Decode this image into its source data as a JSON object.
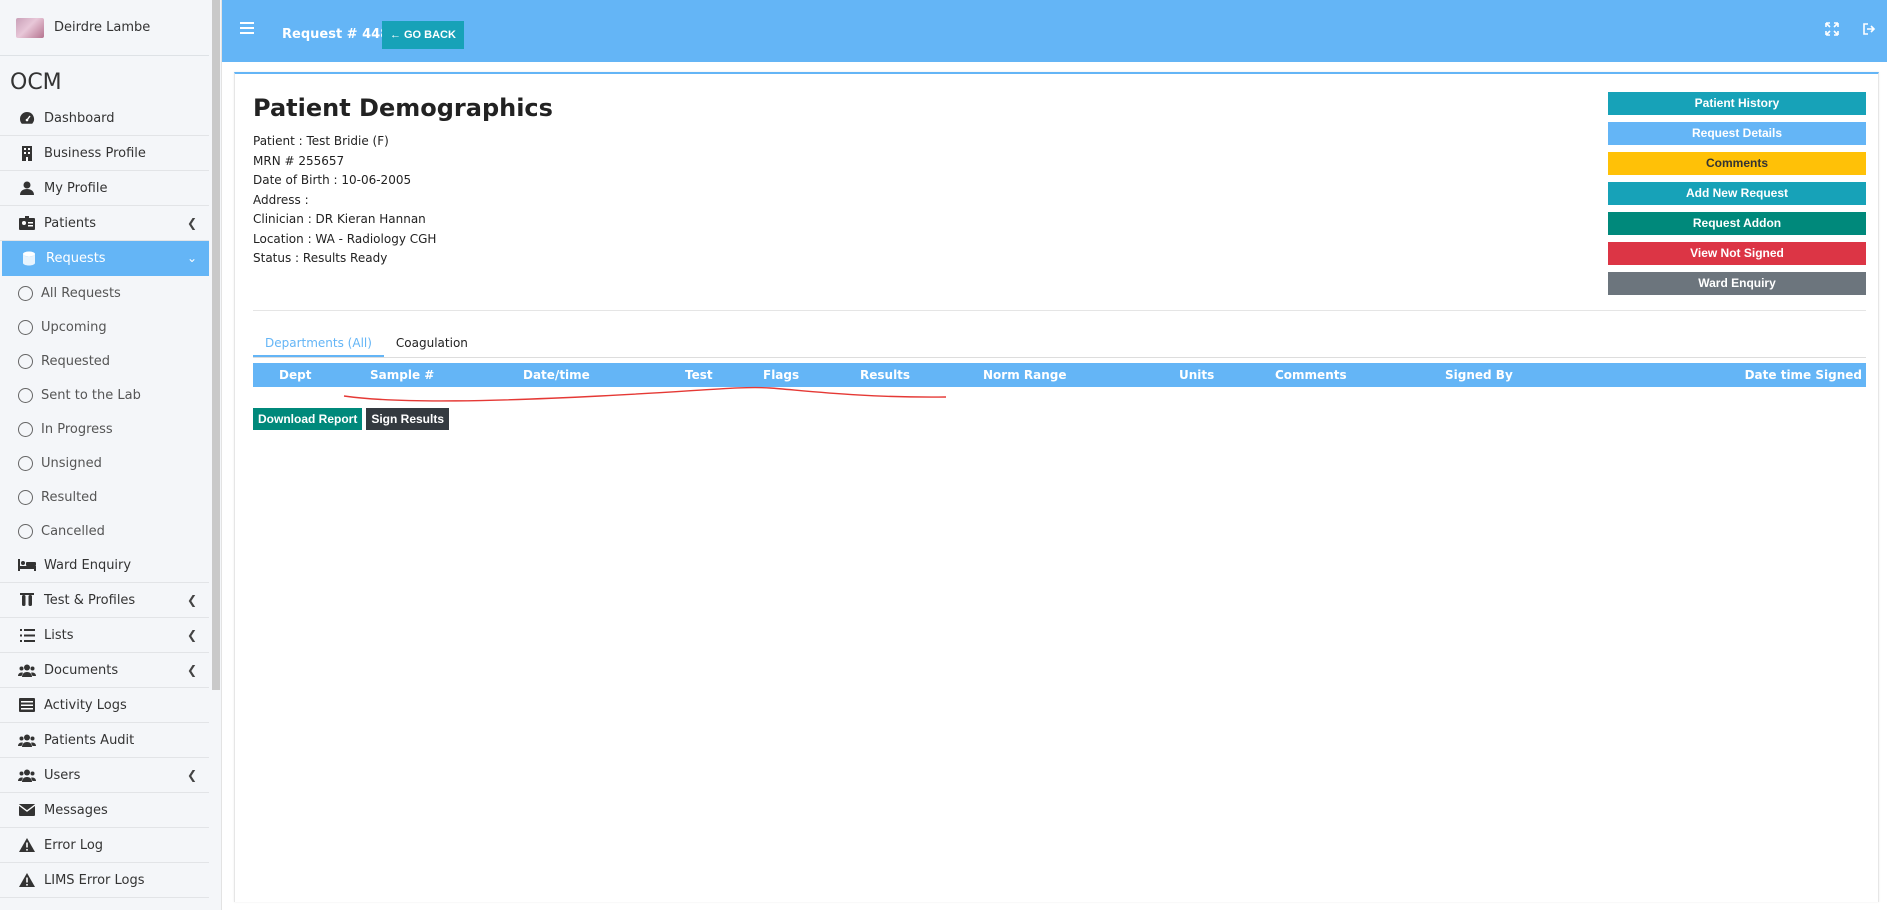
{
  "sidebar": {
    "user_name": "Deirdre Lambe",
    "brand": "OCM",
    "items": [
      {
        "label": "Dashboard",
        "icon": "tachometer-icon"
      },
      {
        "label": "Business Profile",
        "icon": "building-icon"
      },
      {
        "label": "My Profile",
        "icon": "user-icon"
      },
      {
        "label": "Patients",
        "icon": "id-badge-icon",
        "chevron": "left"
      },
      {
        "label": "Requests",
        "icon": "database-icon",
        "chevron": "down",
        "active": true
      }
    ],
    "sub_items": [
      "All Requests",
      "Upcoming",
      "Requested",
      "Sent to the Lab",
      "In Progress",
      "Unsigned",
      "Resulted",
      "Cancelled"
    ],
    "items_after": [
      {
        "label": "Ward Enquiry",
        "icon": "bed-icon"
      },
      {
        "label": "Test & Profiles",
        "icon": "vials-icon",
        "chevron": "left"
      },
      {
        "label": "Lists",
        "icon": "list-icon",
        "chevron": "left"
      },
      {
        "label": "Documents",
        "icon": "users-icon",
        "chevron": "left"
      },
      {
        "label": "Activity Logs",
        "icon": "archive-icon"
      },
      {
        "label": "Patients Audit",
        "icon": "users-icon"
      },
      {
        "label": "Users",
        "icon": "users-icon",
        "chevron": "left"
      },
      {
        "label": "Messages",
        "icon": "envelope-icon"
      },
      {
        "label": "Error Log",
        "icon": "warning-icon"
      },
      {
        "label": "LIMS Error Logs",
        "icon": "warning-icon"
      }
    ]
  },
  "topbar": {
    "request_title": "Request # 44837",
    "go_back_label": "GO BACK"
  },
  "page": {
    "title": "Patient Demographics",
    "patient": "Patient : Test Bridie (F)",
    "mrn": "MRN # 255657",
    "dob": "Date of Birth : 10-06-2005",
    "address": "Address :",
    "clinician": "Clinician : DR Kieran Hannan",
    "location": "Location : WA - Radiology CGH",
    "status": "Status : Results Ready"
  },
  "side_buttons": {
    "patient_history": "Patient History",
    "request_details": "Request Details",
    "comments": "Comments",
    "add_new_request": "Add New Request",
    "request_addon": "Request Addon",
    "view_not_signed": "View Not Signed",
    "ward_enquiry": "Ward Enquiry"
  },
  "tabs": {
    "departments": "Departments (All)",
    "coagulation": "Coagulation"
  },
  "table": {
    "headers": [
      "Dept",
      "Sample #",
      "Date/time",
      "Test",
      "Flags",
      "Results",
      "Norm Range",
      "Units",
      "Comments",
      "Signed By",
      "Date time Signed"
    ]
  },
  "actions": {
    "download_report": "Download Report",
    "sign_results": "Sign Results"
  },
  "colors": {
    "accent": "#64b5f6",
    "teal": "#17a2b8",
    "green": "#00897b",
    "yellow": "#ffc107",
    "red": "#dc3545",
    "gray": "#6c757d",
    "dark": "#343a40",
    "annotation": "#e53935"
  }
}
